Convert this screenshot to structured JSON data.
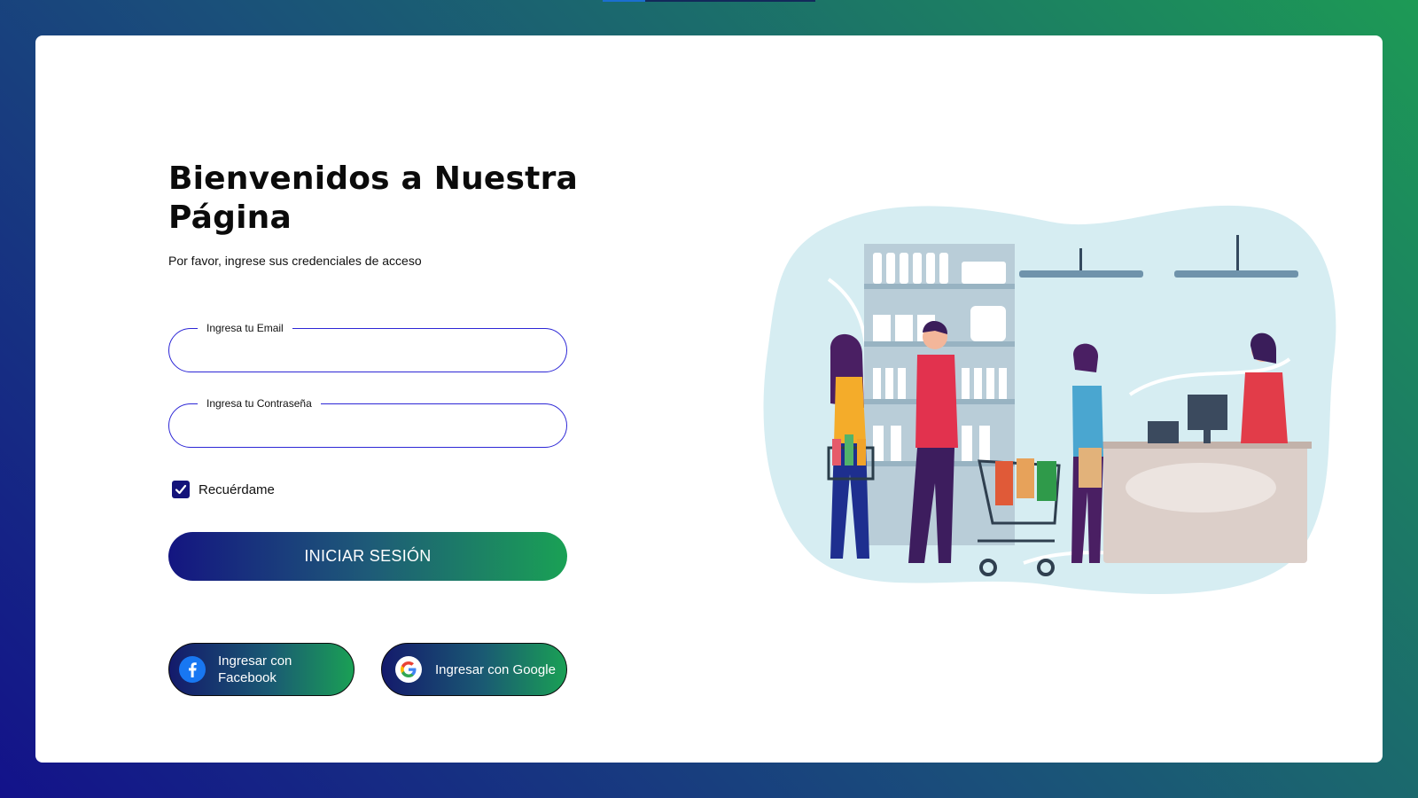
{
  "header": {
    "title": "Bienvenidos a Nuestra Página",
    "subtitle": "Por favor, ingrese sus credenciales de acceso"
  },
  "form": {
    "email": {
      "label": "Ingresa tu Email",
      "value": ""
    },
    "password": {
      "label": "Ingresa tu Contraseña",
      "value": ""
    },
    "remember": {
      "label": "Recuérdame",
      "checked": true
    },
    "submit_label": "INICIAR SESIÓN"
  },
  "social": {
    "facebook_label": "Ingresar con Facebook",
    "google_label": "Ingresar con Google"
  },
  "colors": {
    "accent_blue": "#2d27d6",
    "gradient_start": "#141581",
    "gradient_end": "#1aa155",
    "checkbox": "#14137a"
  },
  "illustration": {
    "icon": "supermarket-checkout-illustration"
  }
}
